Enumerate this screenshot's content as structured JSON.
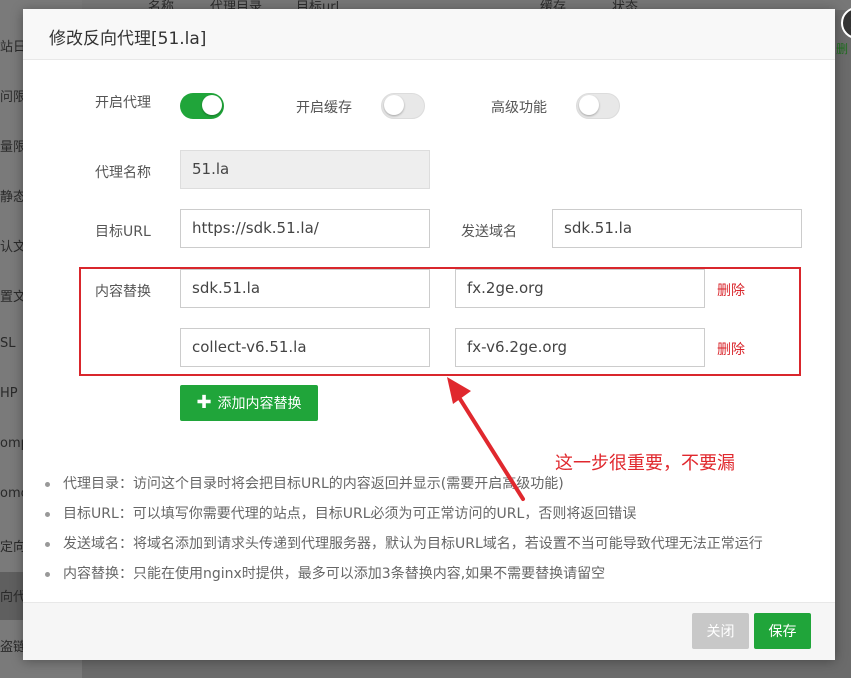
{
  "background": {
    "sidebar_fragments": [
      "站日",
      "问限",
      "量限",
      "静态",
      "认文",
      "置文",
      "SL",
      "HP",
      "omp",
      "omc",
      "定向",
      "向代",
      "盗链"
    ],
    "top_fragments": [
      "名称",
      "代理目录",
      "目标url",
      "缓存",
      "状态"
    ],
    "right_fragment": "删"
  },
  "dialog": {
    "title": "修改反向代理[51.la]",
    "toggles": {
      "enable_proxy": {
        "label": "开启代理",
        "on": true
      },
      "enable_cache": {
        "label": "开启缓存",
        "on": false
      },
      "advanced": {
        "label": "高级功能",
        "on": false
      }
    },
    "proxy_name": {
      "label": "代理名称",
      "value": "51.la"
    },
    "target_url": {
      "label": "目标URL",
      "value": "https://sdk.51.la/"
    },
    "send_domain": {
      "label": "发送域名",
      "value": "sdk.51.la"
    },
    "content_replace": {
      "label": "内容替换",
      "rows": [
        {
          "from": "sdk.51.la",
          "to": "fx.2ge.org",
          "delete_label": "删除"
        },
        {
          "from": "collect-v6.51.la",
          "to": "fx-v6.2ge.org",
          "delete_label": "删除"
        }
      ],
      "add_button": "添加内容替换"
    },
    "annotation": "这一步很重要，不要漏",
    "tips": [
      "代理目录：访问这个目录时将会把目标URL的内容返回并显示(需要开启高级功能)",
      "目标URL：可以填写你需要代理的站点，目标URL必须为可正常访问的URL，否则将返回错误",
      "发送域名：将域名添加到请求头传递到代理服务器，默认为目标URL域名，若设置不当可能导致代理无法正常运行",
      "内容替换：只能在使用nginx时提供，最多可以添加3条替换内容,如果不需要替换请留空"
    ],
    "footer": {
      "close_label": "关闭",
      "save_label": "保存"
    }
  },
  "colors": {
    "accent": "#20a53a",
    "danger": "#d9262c",
    "annotation": "#e0282e"
  }
}
